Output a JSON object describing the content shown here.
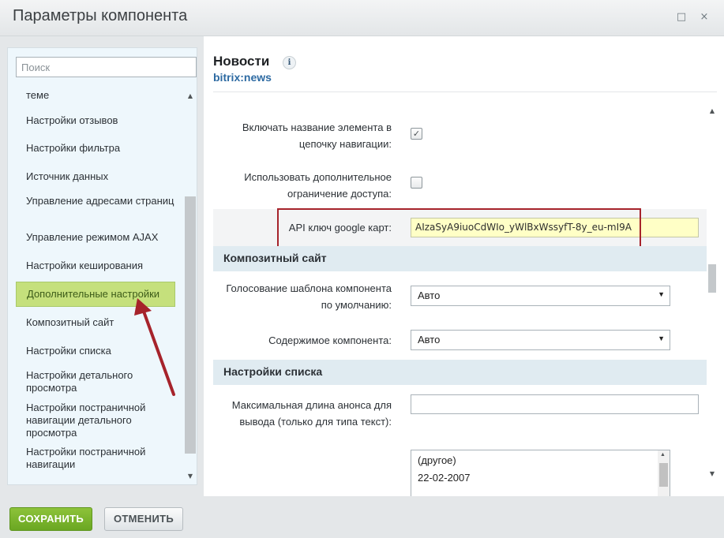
{
  "window": {
    "title": "Параметры компонента",
    "maximize_icon": "□",
    "close_icon": "×"
  },
  "sidebar": {
    "search_placeholder": "Поиск",
    "items": [
      {
        "label": "теме"
      },
      {
        "label": "Настройки отзывов"
      },
      {
        "label": "Настройки фильтра"
      },
      {
        "label": "Источник данных"
      },
      {
        "label": "Управление адресами страниц"
      },
      {
        "label": "Управление режимом AJAX"
      },
      {
        "label": "Настройки кеширования"
      },
      {
        "label": "Дополнительные настройки",
        "active": true
      },
      {
        "label": "Композитный сайт"
      },
      {
        "label": "Настройки списка"
      },
      {
        "label": "Настройки детального просмотра"
      },
      {
        "label": "Настройки постраничной навигации детального просмотра"
      },
      {
        "label": "Настройки постраничной навигации"
      }
    ]
  },
  "component": {
    "name": "Новости",
    "code": "bitrix:news",
    "info_icon": "i"
  },
  "form": {
    "include_name_label": "Включать название элемента в цепочку навигации:",
    "include_name_checked": true,
    "extra_access_label": "Использовать дополнительное ограничение доступа:",
    "extra_access_checked": false,
    "api_key_label": "API ключ google карт:",
    "api_key_value": "AIzaSyA9iuoCdWIo_yWlBxWssyfT-8y_eu-mI9A",
    "composite_section": "Композитный сайт",
    "template_vote_label": "Голосование шаблона компонента по умолчанию:",
    "template_vote_value": "Авто",
    "component_content_label": "Содержимое компонента:",
    "component_content_value": "Авто",
    "list_section": "Настройки списка",
    "preview_length_label": "Максимальная длина анонса для вывода (только для типа текст):",
    "preview_length_value": "",
    "date_options": [
      "(другое)",
      "22-02-2007"
    ]
  },
  "footer": {
    "save_label": "СОХРАНИТЬ",
    "cancel_label": "ОТМЕНИТЬ"
  },
  "colors": {
    "active_item": "#c5e07c",
    "save_button": "#7ab52d",
    "annotation": "#a6232b",
    "api_input_bg": "#ffffc6"
  }
}
